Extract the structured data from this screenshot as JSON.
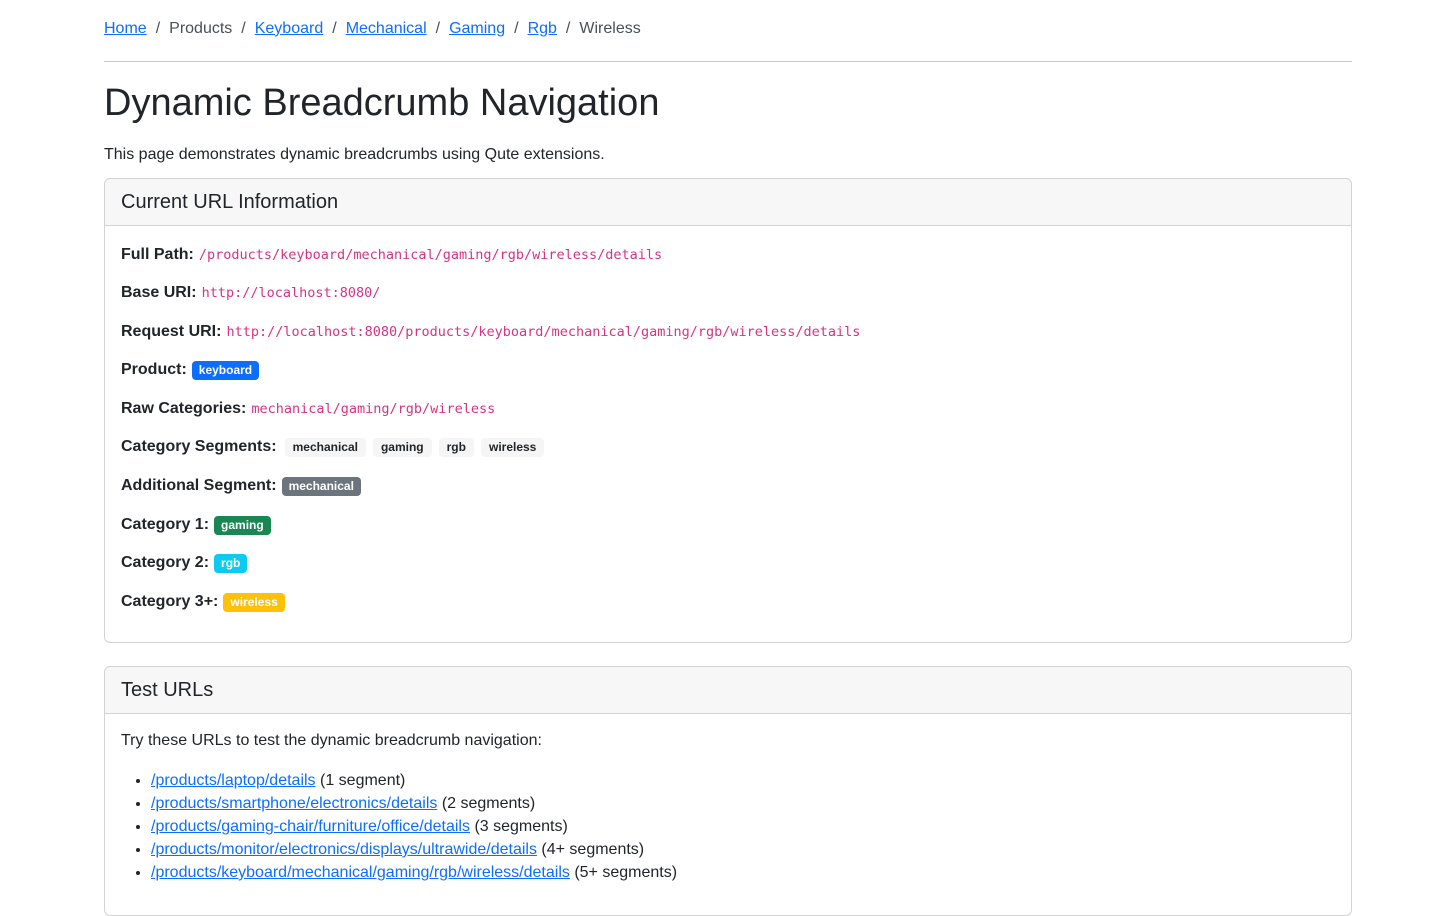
{
  "breadcrumb": [
    {
      "label": "Home",
      "link": true
    },
    {
      "label": "Products",
      "link": false
    },
    {
      "label": "Keyboard",
      "link": true
    },
    {
      "label": "Mechanical",
      "link": true
    },
    {
      "label": "Gaming",
      "link": true
    },
    {
      "label": "Rgb",
      "link": true
    },
    {
      "label": "Wireless",
      "link": false
    }
  ],
  "page": {
    "title": "Dynamic Breadcrumb Navigation",
    "intro": "This page demonstrates dynamic breadcrumbs using Qute extensions."
  },
  "url_info": {
    "header": "Current URL Information",
    "full_path_label": "Full Path:",
    "full_path": "/products/keyboard/mechanical/gaming/rgb/wireless/details",
    "base_uri_label": "Base URI:",
    "base_uri": "http://localhost:8080/",
    "request_uri_label": "Request URI:",
    "request_uri": "http://localhost:8080/products/keyboard/mechanical/gaming/rgb/wireless/details",
    "product_label": "Product:",
    "product": "keyboard",
    "raw_categories_label": "Raw Categories:",
    "raw_categories": "mechanical/gaming/rgb/wireless",
    "segments_label": "Category Segments:",
    "segments": [
      "mechanical",
      "gaming",
      "rgb",
      "wireless"
    ],
    "additional_label": "Additional Segment:",
    "additional": "mechanical",
    "cat1_label": "Category 1:",
    "cat1": "gaming",
    "cat2_label": "Category 2:",
    "cat2": "rgb",
    "cat3_label": "Category 3+:",
    "cat3": "wireless"
  },
  "colors": {
    "primary": "#0d6efd",
    "secondary": "#6c757d",
    "success": "#198754",
    "info": "#0dcaf0",
    "warning": "#ffc107",
    "code": "#d63384"
  },
  "test_urls": {
    "header": "Test URLs",
    "intro": "Try these URLs to test the dynamic breadcrumb navigation:",
    "items": [
      {
        "url": "/products/laptop/details",
        "note": "(1 segment)"
      },
      {
        "url": "/products/smartphone/electronics/details",
        "note": "(2 segments)"
      },
      {
        "url": "/products/gaming-chair/furniture/office/details",
        "note": "(3 segments)"
      },
      {
        "url": "/products/monitor/electronics/displays/ultrawide/details",
        "note": "(4+ segments)"
      },
      {
        "url": "/products/keyboard/mechanical/gaming/rgb/wireless/details",
        "note": "(5+ segments)"
      }
    ]
  }
}
